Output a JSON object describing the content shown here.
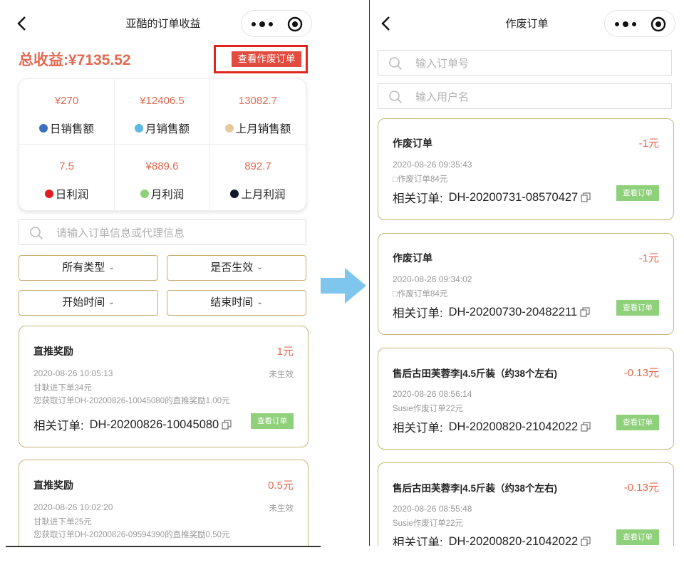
{
  "left": {
    "nav_title": "亚酷的订单收益",
    "total_label": "总收益:",
    "total_value": "¥7135.52",
    "void_button_label": "查看作废订单",
    "stats": [
      {
        "value": "¥270",
        "label": "日销售额",
        "dot_color": "#3b70c0"
      },
      {
        "value": "¥12406.5",
        "label": "月销售额",
        "dot_color": "#5bb9e3"
      },
      {
        "value": "13082.7",
        "label": "上月销售额",
        "dot_color": "#e8c9a0"
      },
      {
        "value": "7.5",
        "label": "日利润",
        "dot_color": "#e02020"
      },
      {
        "value": "¥889.6",
        "label": "月利润",
        "dot_color": "#8fd07b"
      },
      {
        "value": "892.7",
        "label": "上月利润",
        "dot_color": "#111827"
      }
    ],
    "search_placeholder": "请输入订单信息或代理信息",
    "filters": {
      "type": "所有类型",
      "effective": "是否生效",
      "start": "开始时间",
      "end": "结束时间"
    },
    "cards": [
      {
        "title": "直推奖励",
        "amount": "1元",
        "time": "2020-08-26 10:05:13",
        "status": "未生效",
        "note1": "甘耿进下单34元",
        "note2": "您获取订单DH-20200826-10045080的直推奖励1.00元",
        "related_label": "相关订单:",
        "related_value": "DH-20200826-10045080",
        "view_label": "查看订单"
      },
      {
        "title": "直推奖励",
        "amount": "0.5元",
        "time": "2020-08-26 10:02:20",
        "status": "未生效",
        "note1": "甘耿进下单25元",
        "note2": "您获取订单DH-20200826-09594390的直推奖励0.50元"
      }
    ]
  },
  "right": {
    "nav_title": "作废订单",
    "search_order_placeholder": "输入订单号",
    "search_user_placeholder": "输入用户名",
    "cards": [
      {
        "title": "作废订单",
        "amount": "-1元",
        "time": "2020-08-26 09:35:43",
        "note": "□作废订单84元",
        "related_label": "相关订单:",
        "related_value": "DH-20200731-08570427",
        "view_label": "查看订单"
      },
      {
        "title": "作废订单",
        "amount": "-1元",
        "time": "2020-08-26 09:34:02",
        "note": "□作废订单84元",
        "related_label": "相关订单:",
        "related_value": "DH-20200730-20482211",
        "view_label": "查看订单"
      },
      {
        "title": "售后古田芙蓉李|4.5斤装（约38个左右)",
        "amount": "-0.13元",
        "time": "2020-08-26 08:56:14",
        "note": "Susie作废订单22元",
        "related_label": "相关订单:",
        "related_value": "DH-20200820-21042022",
        "view_label": "查看订单"
      },
      {
        "title": "售后古田芙蓉李|4.5斤装（约38个左右)",
        "amount": "-0.13元",
        "time": "2020-08-26 08:55:48",
        "note": "Susie作废订单22元",
        "related_label": "相关订单:",
        "related_value": "DH-20200820-21042022",
        "view_label": "查看订单"
      }
    ]
  },
  "colors": {
    "accent": "#e26a51",
    "highlight": "#e0251b",
    "card_border": "#c8b57a",
    "view_button": "#8fd07b",
    "arrow": "#7ec6ec"
  },
  "icons": [
    "back-arrow-icon",
    "more-dots-icon",
    "record-circle-icon",
    "search-icon",
    "chevron-down-icon",
    "copy-icon",
    "right-arrow-icon"
  ]
}
